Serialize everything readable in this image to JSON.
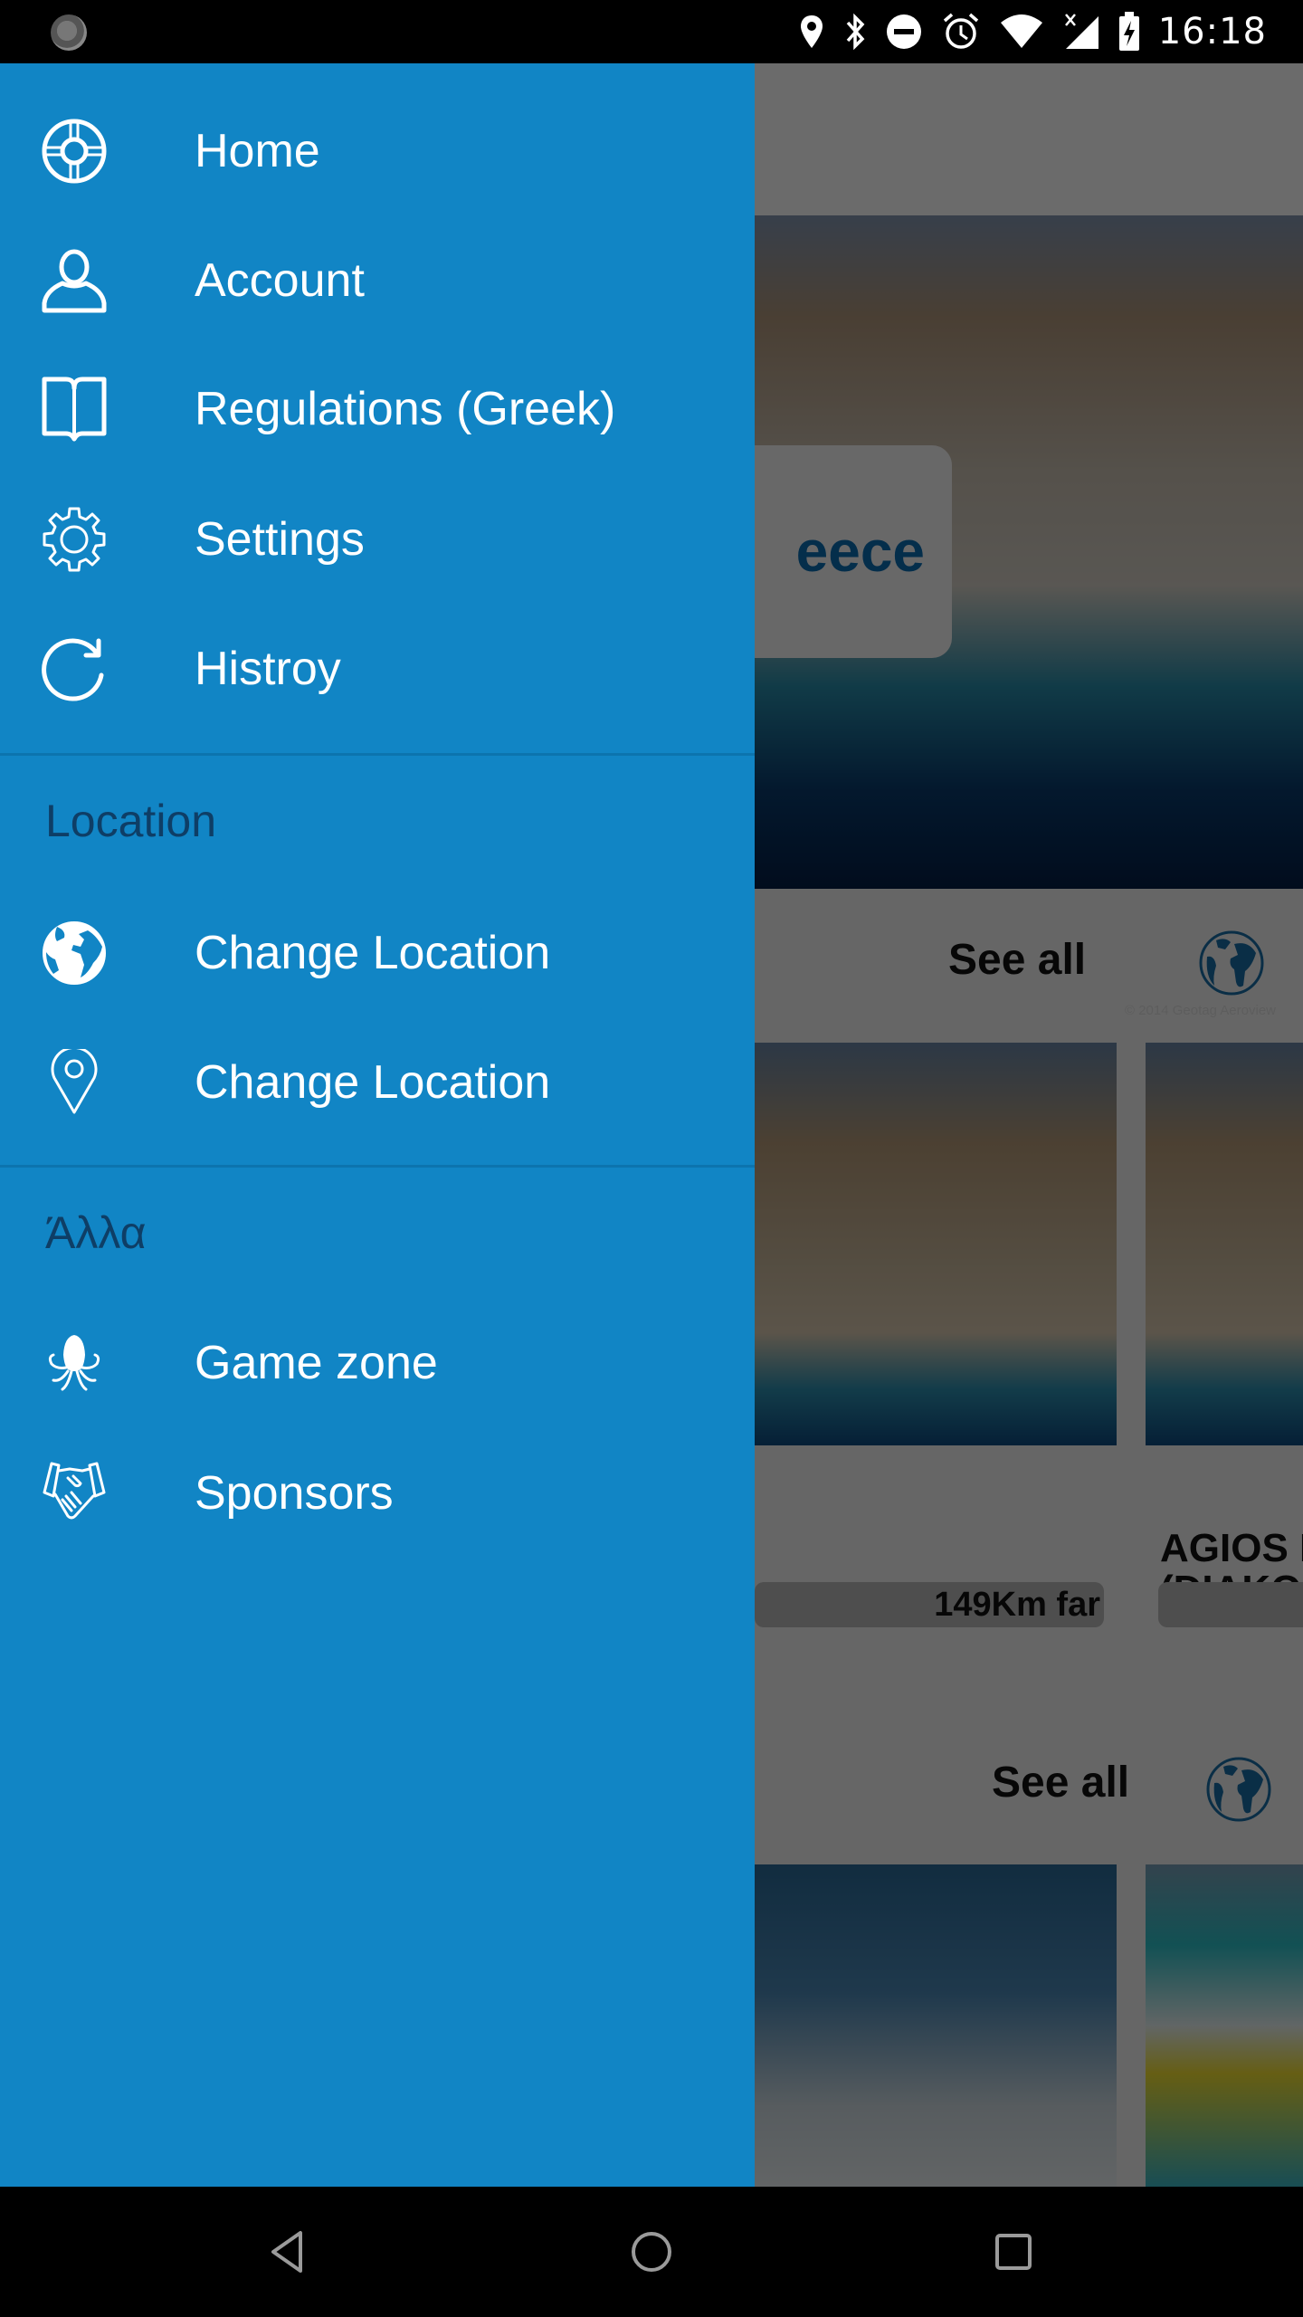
{
  "status_bar": {
    "time": "16:18",
    "icons": [
      "app-notification-icon",
      "location-icon",
      "bluetooth-icon",
      "do-not-disturb-icon",
      "alarm-icon",
      "wifi-icon",
      "cellular-no-data-icon",
      "battery-charging-icon"
    ]
  },
  "drawer": {
    "primary_items": [
      {
        "label": "Home",
        "icon": "lifebuoy-icon"
      },
      {
        "label": "Account",
        "icon": "user-icon"
      },
      {
        "label": "Regulations (Greek)",
        "icon": "book-icon"
      },
      {
        "label": "Settings",
        "icon": "gear-icon"
      },
      {
        "label": "Histroy",
        "icon": "refresh-icon"
      }
    ],
    "location_section": {
      "title": "Location",
      "items": [
        {
          "label": "Change Location",
          "icon": "globe-icon"
        },
        {
          "label": "Change Location",
          "icon": "map-pin-icon"
        }
      ]
    },
    "other_section": {
      "title": "Άλλα",
      "items": [
        {
          "label": "Game zone",
          "icon": "octopus-icon"
        },
        {
          "label": "Sponsors",
          "icon": "handshake-icon"
        }
      ]
    },
    "colors": {
      "background": "#1185c5",
      "section_title": "#0e3e66",
      "text": "#ffffff"
    }
  },
  "background_screen": {
    "hero": {
      "title_fragment": "eece",
      "copyright": "© 2014 Geotag Aeroview"
    },
    "section_1": {
      "see_all": "See all",
      "cards": [
        {
          "title": "",
          "distance": "149Km far",
          "image_credit": "© 2014 Geotag Aeroview"
        },
        {
          "title": "AGIOS I\n(DIAKO",
          "distance": ""
        }
      ]
    },
    "section_2": {
      "see_all": "See all"
    }
  },
  "nav_bar": {
    "buttons": [
      "back",
      "home",
      "recents"
    ]
  }
}
